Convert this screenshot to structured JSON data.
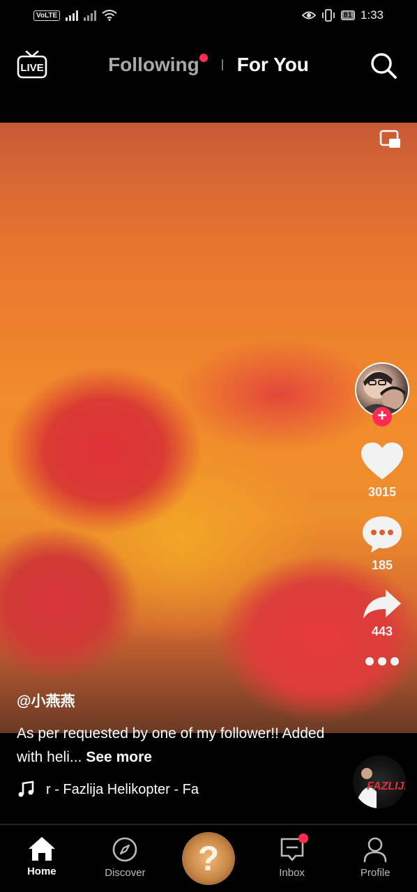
{
  "status_bar": {
    "volte": "VoLTE",
    "battery": "81",
    "time": "1:33"
  },
  "top_nav": {
    "live_label": "LIVE",
    "following": "Following",
    "for_you": "For You"
  },
  "video": {
    "username": "@小燕燕",
    "description": "As per requested by one of my follower!! Added with heli...",
    "see_more": "See more",
    "music": "r - Fazlija    Helikopter - Fa",
    "disc_label": "FAZLIJA"
  },
  "actions": {
    "likes": "3015",
    "comments": "185",
    "shares": "443"
  },
  "bottom_nav": {
    "home": "Home",
    "discover": "Discover",
    "create": "?",
    "inbox": "Inbox",
    "profile": "Profile"
  },
  "colors": {
    "accent": "#fe2c55"
  }
}
